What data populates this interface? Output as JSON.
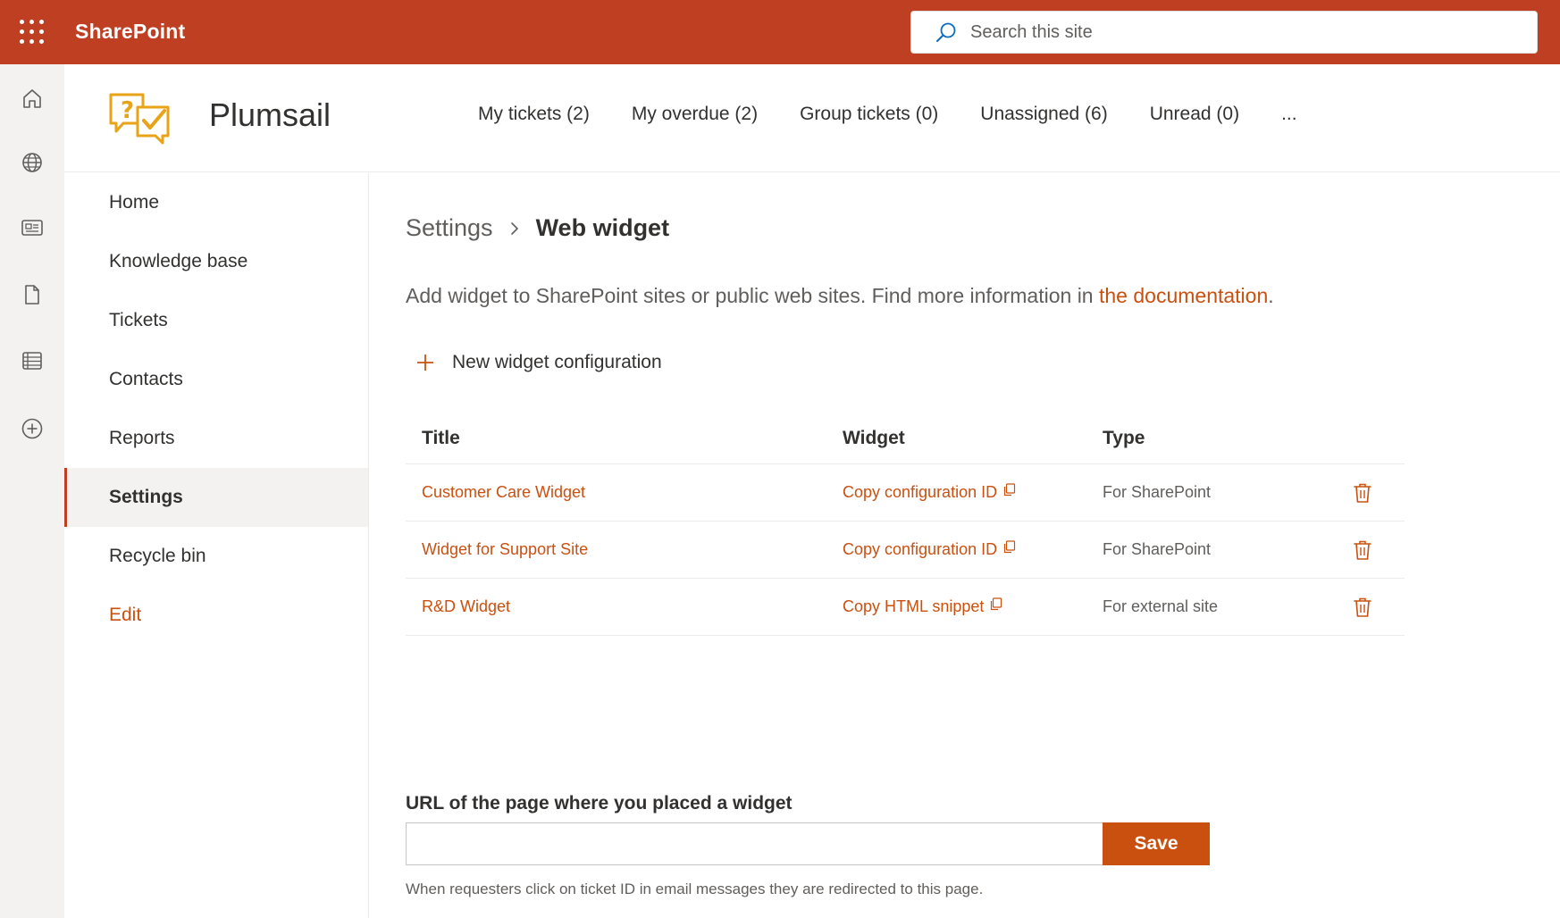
{
  "suite": {
    "brand": "SharePoint",
    "search_placeholder": "Search this site"
  },
  "site": {
    "title": "Plumsail",
    "top_nav": [
      {
        "label": "My tickets (2)"
      },
      {
        "label": "My overdue (2)"
      },
      {
        "label": "Group tickets (0)"
      },
      {
        "label": "Unassigned (6)"
      },
      {
        "label": "Unread (0)"
      },
      {
        "label": "..."
      }
    ]
  },
  "appbar": {
    "icons": [
      "home-icon",
      "globe-icon",
      "news-icon",
      "document-icon",
      "list-icon",
      "add-icon"
    ]
  },
  "left_nav": {
    "items": [
      {
        "label": "Home"
      },
      {
        "label": "Knowledge base"
      },
      {
        "label": "Tickets"
      },
      {
        "label": "Contacts"
      },
      {
        "label": "Reports"
      },
      {
        "label": "Settings",
        "active": true
      },
      {
        "label": "Recycle bin"
      },
      {
        "label": "Edit"
      }
    ]
  },
  "main": {
    "breadcrumb": {
      "parent": "Settings",
      "current": "Web widget"
    },
    "description": {
      "text": "Add widget to SharePoint sites or public web sites. Find more information in ",
      "link": "the documentation",
      "suffix": "."
    },
    "new_button": "New widget configuration",
    "table": {
      "headers": {
        "title": "Title",
        "widget": "Widget",
        "type": "Type"
      },
      "rows": [
        {
          "title": "Customer Care Widget",
          "widget": "Copy configuration ID",
          "type": "For SharePoint"
        },
        {
          "title": "Widget for Support Site",
          "widget": "Copy configuration ID",
          "type": "For SharePoint"
        },
        {
          "title": "R&D Widget",
          "widget": "Copy HTML snippet",
          "type": "For external site"
        }
      ]
    },
    "url_section": {
      "label": "URL of the page where you placed a widget",
      "value": "",
      "save_label": "Save",
      "hint": "When requesters click on ticket ID in email messages they are redirected to this page."
    }
  },
  "colors": {
    "suite_bar": "#bf3f22",
    "accent": "#ca5010",
    "logo": "#e8a317"
  }
}
